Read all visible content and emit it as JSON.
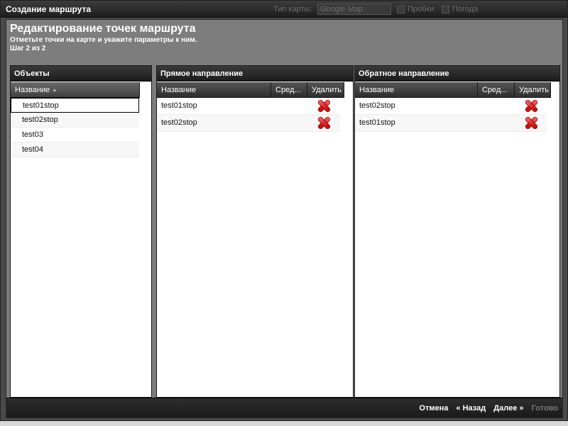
{
  "window": {
    "title": "Создание маршрута",
    "background_toolbar": {
      "map_type_label": "Тип карты:",
      "map_type_value": "Google Map",
      "traffic_label": "Пробки",
      "weather_label": "Погода"
    }
  },
  "header": {
    "title": "Редактирование точек маршрута",
    "subtitle": "Отметьте точки на карте и укажите параметры к ним.",
    "step": "Шаг 2 из 2"
  },
  "objects_panel": {
    "title": "Объекты",
    "column": "Название",
    "items": [
      "test01stop",
      "test02stop",
      "test03",
      "test04"
    ],
    "selected_index": 0
  },
  "forward_panel": {
    "title": "Прямое направление",
    "columns": [
      "Название",
      "Сред...",
      "Удалить"
    ],
    "rows": [
      {
        "name": "test01stop",
        "avg": ""
      },
      {
        "name": "test02stop",
        "avg": ""
      }
    ]
  },
  "reverse_panel": {
    "title": "Обратное направление",
    "columns": [
      "Название",
      "Сред...",
      "Удалить"
    ],
    "rows": [
      {
        "name": "test02stop",
        "avg": ""
      },
      {
        "name": "test01stop",
        "avg": ""
      }
    ]
  },
  "footer": {
    "cancel": "Отмена",
    "back": "« Назад",
    "next": "Далее »",
    "done": "Готово"
  },
  "icons": {
    "delete": "delete-x-icon",
    "sort": "sort-asc-icon"
  },
  "colors": {
    "delete_red": "#d40000",
    "accent_orange": "#e8891a",
    "disabled_text": "#777777"
  }
}
